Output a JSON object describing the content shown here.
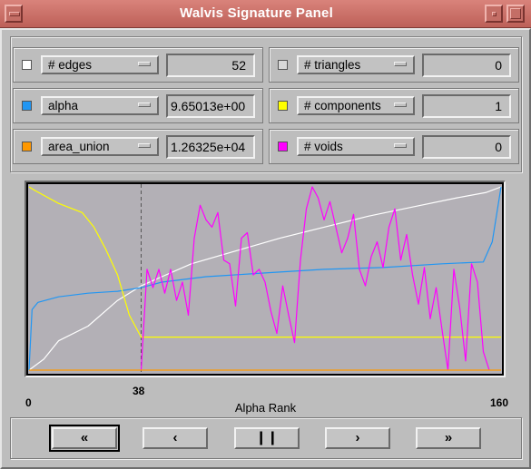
{
  "window": {
    "title": "Walvis Signature Panel"
  },
  "fields_left": [
    {
      "label": "# edges",
      "value": "52",
      "swatch": "#ffffff"
    },
    {
      "label": "alpha",
      "value": "9.65013e+00",
      "swatch": "#2196f3"
    },
    {
      "label": "area_union",
      "value": "1.26325e+04",
      "swatch": "#ff9800"
    }
  ],
  "fields_right": [
    {
      "label": "# triangles",
      "value": "0",
      "swatch": "#d8d8d8"
    },
    {
      "label": "# components",
      "value": "1",
      "swatch": "#ffff00"
    },
    {
      "label": "# voids",
      "value": "0",
      "swatch": "#ff00ff"
    }
  ],
  "plot": {
    "background": "#b3b0b6",
    "xlabel": "Alpha Rank",
    "x_min_label": "0",
    "marker_label": "38",
    "x_max_label": "160",
    "marker_rank": 38,
    "max_rank": 160
  },
  "chart_data": {
    "type": "line",
    "xlabel": "Alpha Rank",
    "xlim": [
      0,
      160
    ],
    "ylim": [
      0,
      1
    ],
    "marker_x": 38,
    "series": [
      {
        "name": "# edges",
        "color": "#ffffff",
        "x": [
          0,
          5,
          10,
          20,
          30,
          38,
          45,
          55,
          70,
          85,
          100,
          115,
          130,
          145,
          155,
          160
        ],
        "values": [
          0.0,
          0.06,
          0.16,
          0.24,
          0.38,
          0.46,
          0.51,
          0.58,
          0.65,
          0.72,
          0.78,
          0.84,
          0.89,
          0.94,
          0.97,
          1.0
        ]
      },
      {
        "name": "alpha",
        "color": "#2196f3",
        "x": [
          0,
          1,
          3,
          10,
          20,
          30,
          38,
          45,
          60,
          80,
          100,
          120,
          140,
          154,
          157,
          160
        ],
        "values": [
          0.0,
          0.33,
          0.37,
          0.4,
          0.42,
          0.43,
          0.45,
          0.48,
          0.51,
          0.53,
          0.55,
          0.56,
          0.58,
          0.59,
          0.7,
          1.0
        ]
      },
      {
        "name": "# components",
        "color": "#ffff00",
        "x": [
          0,
          2,
          10,
          18,
          22,
          26,
          30,
          34,
          38,
          160
        ],
        "values": [
          1.0,
          0.98,
          0.91,
          0.86,
          0.78,
          0.66,
          0.52,
          0.3,
          0.18,
          0.18
        ]
      },
      {
        "name": "# voids",
        "color": "#ff00ff",
        "x": [
          38,
          40,
          42,
          44,
          46,
          48,
          50,
          52,
          54,
          56,
          58,
          60,
          62,
          64,
          66,
          68,
          70,
          72,
          74,
          76,
          78,
          80,
          82,
          84,
          86,
          88,
          90,
          92,
          94,
          96,
          98,
          100,
          102,
          104,
          106,
          108,
          110,
          112,
          114,
          116,
          118,
          120,
          122,
          124,
          126,
          128,
          130,
          132,
          134,
          136,
          138,
          140,
          142,
          144,
          146,
          148,
          150,
          152,
          154,
          156
        ],
        "values": [
          0.0,
          0.55,
          0.45,
          0.55,
          0.42,
          0.55,
          0.38,
          0.48,
          0.3,
          0.72,
          0.9,
          0.82,
          0.78,
          0.86,
          0.6,
          0.58,
          0.35,
          0.72,
          0.75,
          0.52,
          0.55,
          0.48,
          0.32,
          0.2,
          0.46,
          0.3,
          0.15,
          0.6,
          0.88,
          1.0,
          0.94,
          0.82,
          0.92,
          0.78,
          0.64,
          0.72,
          0.85,
          0.55,
          0.46,
          0.62,
          0.7,
          0.56,
          0.78,
          0.88,
          0.6,
          0.74,
          0.52,
          0.36,
          0.56,
          0.28,
          0.45,
          0.22,
          0.0,
          0.55,
          0.34,
          0.05,
          0.58,
          0.48,
          0.1,
          0.0
        ]
      },
      {
        "name": "area_union",
        "color": "#ff9800",
        "x": [
          0,
          160
        ],
        "values": [
          0.0,
          0.0
        ]
      }
    ]
  },
  "nav": {
    "first": "«",
    "prev": "‹",
    "pause": "❙❙",
    "next": "›",
    "last": "»"
  }
}
